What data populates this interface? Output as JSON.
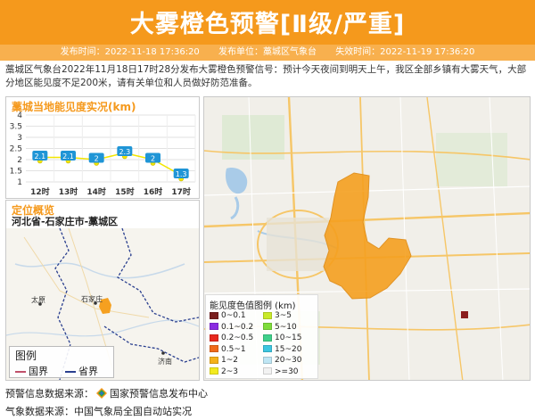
{
  "header": {
    "title": "大雾橙色预警[Ⅱ级/严重]",
    "publish_time": "发布时间：2022-11-18 17:36:20",
    "publisher": "发布单位：藁城区气象台",
    "expire_time": "失效时间：2022-11-19 17:36:20"
  },
  "description": "藁城区气象台2022年11月18日17时28分发布大雾橙色预警信号：预计今天夜间到明天上午，我区全部乡镇有大雾天气，大部分地区能见度不足200米，请有关单位和人员做好防范准备。",
  "visibility_panel": {
    "title": "藁城当地能见度实况(km)"
  },
  "chart_data": {
    "type": "line",
    "title": "藁城当地能见度实况(km)",
    "categories": [
      "12时",
      "13时",
      "14时",
      "15时",
      "16时",
      "17时"
    ],
    "series": [
      {
        "values": [
          2.1,
          2.1,
          2,
          2.3,
          2,
          1.3
        ]
      }
    ],
    "y_ticks": [
      "1",
      "1.5",
      "2",
      "2.5",
      "3",
      "3.5",
      "4"
    ],
    "ylim": [
      1,
      4
    ],
    "grid": true,
    "colors": {
      "line": "#f2e600",
      "label_bg": "#1f95d6"
    }
  },
  "location_panel": {
    "title": "定位概览",
    "path": "河北省-石家庄市-藁城区",
    "city_labels": [
      "太原",
      "石家庄",
      "济南"
    ],
    "legend": {
      "title": "图例",
      "items": [
        {
          "label": "国界",
          "color": "#c0506a"
        },
        {
          "label": "省界",
          "color": "#2a3f8f"
        }
      ]
    }
  },
  "map_legend": {
    "title": "能见度色值图例 (km)",
    "items": [
      {
        "label": "0~0.1",
        "color": "#7a1f1f"
      },
      {
        "label": "0.1~0.2",
        "color": "#8a2be2"
      },
      {
        "label": "0.2~0.5",
        "color": "#e8281e"
      },
      {
        "label": "0.5~1",
        "color": "#f06a1a"
      },
      {
        "label": "1~2",
        "color": "#f5b21a"
      },
      {
        "label": "2~3",
        "color": "#f3ea1e"
      },
      {
        "label": "3~5",
        "color": "#c9ea2a"
      },
      {
        "label": "5~10",
        "color": "#7edc3a"
      },
      {
        "label": "10~15",
        "color": "#3fd08a"
      },
      {
        "label": "15~20",
        "color": "#3cc6e0"
      },
      {
        "label": "20~30",
        "color": "#bfe6f4"
      },
      {
        "label": ">=30",
        "color": "#f2f2f2"
      }
    ]
  },
  "footer": {
    "source_warning": "预警信息数据来源：",
    "source_warning_name": "国家预警信息发布中心",
    "source_weather": "气象数据来源：中国气象局全国自动站实况"
  },
  "colors": {
    "brand": "#f5991c",
    "sub": "#f8b04e",
    "warning_area": "#f5a020"
  }
}
